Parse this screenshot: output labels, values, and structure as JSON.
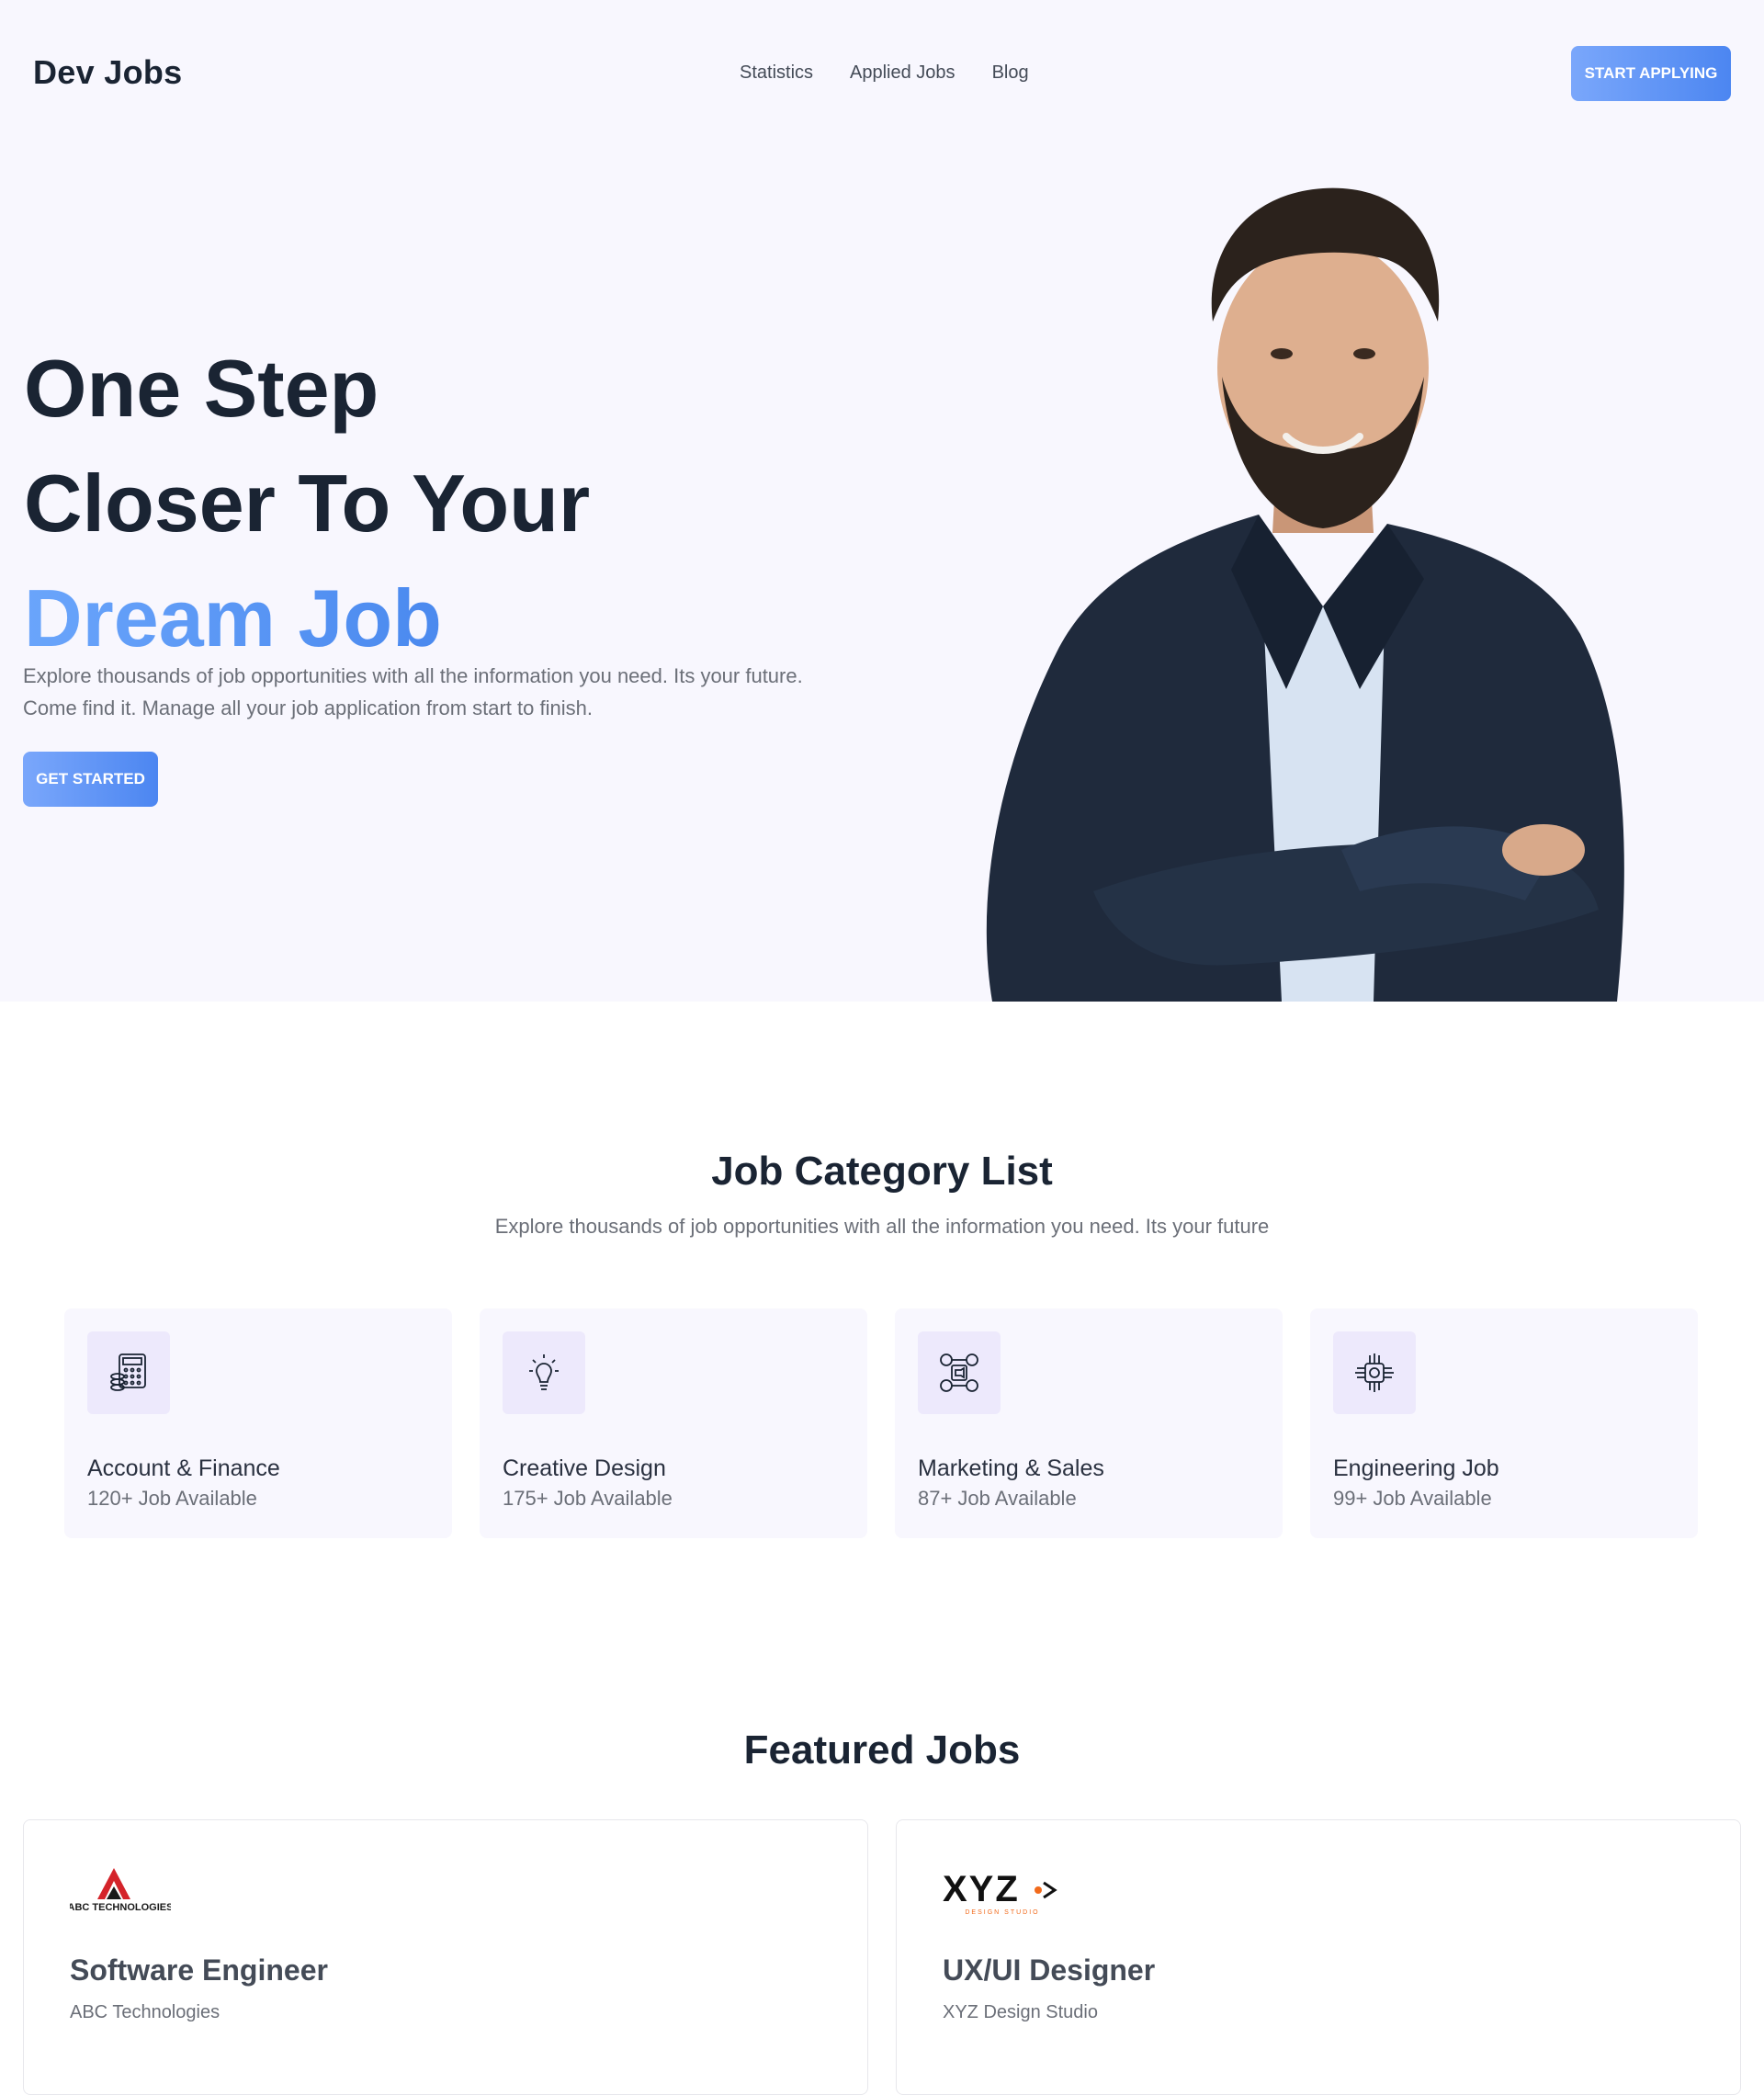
{
  "nav": {
    "brand": "Dev Jobs",
    "links": [
      "Statistics",
      "Applied Jobs",
      "Blog"
    ],
    "cta": "START APPLYING"
  },
  "hero": {
    "title_line1": "One Step",
    "title_line2": "Closer To Your",
    "title_accent": "Dream Job",
    "description": "Explore thousands of job opportunities with all the information you need. Its your future. Come find it. Manage all your job application from start to finish.",
    "cta": "GET STARTED"
  },
  "categories": {
    "title": "Job Category List",
    "subtitle": "Explore thousands of job opportunities with all the information you need. Its your future",
    "items": [
      {
        "name": "Account & Finance",
        "count": "120+ Job Available",
        "icon": "calculator-icon"
      },
      {
        "name": "Creative Design",
        "count": "175+ Job Available",
        "icon": "lightbulb-icon"
      },
      {
        "name": "Marketing & Sales",
        "count": "87+ Job Available",
        "icon": "social-media-icon"
      },
      {
        "name": "Engineering Job",
        "count": "99+ Job Available",
        "icon": "chip-icon"
      }
    ]
  },
  "featured": {
    "title": "Featured Jobs",
    "jobs": [
      {
        "title": "Software Engineer",
        "company": "ABC Technologies",
        "logo_text": "ABC TECHNOLOGIES"
      },
      {
        "title": "UX/UI Designer",
        "company": "XYZ Design Studio",
        "logo_text": "XYZ",
        "logo_subtext": "DESIGN STUDIO"
      }
    ]
  },
  "colors": {
    "accent": "#5a95f5",
    "hero_bg": "#f8f7fe",
    "text_dark": "#1a2433",
    "text_muted": "#6b6f78"
  }
}
